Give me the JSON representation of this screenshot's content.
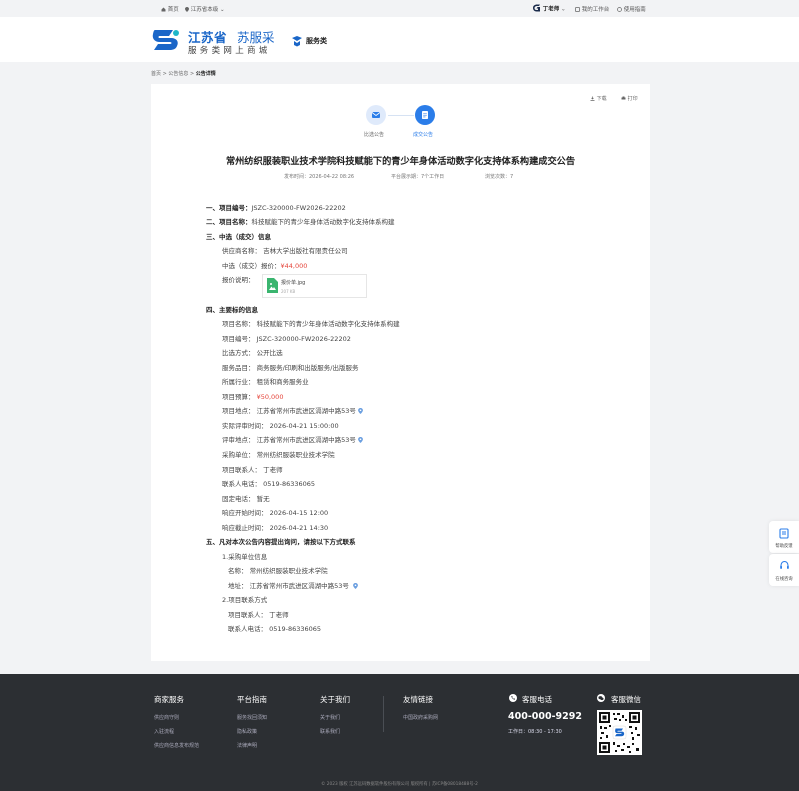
{
  "topbar": {
    "home": "首页",
    "region": "江苏省本级",
    "user": "丁老师",
    "workbench": "我的工作台",
    "guide": "使用指南"
  },
  "header": {
    "brand_cn": "江苏省",
    "brand_name": "苏服采",
    "brand_slogan": "服务类网上商城",
    "service_tag": "服务类"
  },
  "breadcrumb": [
    "首页",
    "公告信息",
    "公告详情"
  ],
  "toolbar": {
    "download": "下载",
    "print": "打印"
  },
  "steps": [
    {
      "label": "比选公告",
      "active": false
    },
    {
      "label": "成交公告",
      "active": true
    }
  ],
  "notice": {
    "title": "常州纺织服装职业技术学院科技赋能下的青少年身体活动数字化支持体系构建成交公告",
    "publish_time": "发布时间：2026-04-22 08:26",
    "display_period": "平台展示期：7个工作日",
    "views": "浏览次数：7"
  },
  "sections": {
    "s1_label": "一、项目编号：",
    "s1_value": "JSZC-320000-FW2026-22202",
    "s2_label": "二、项目名称：",
    "s2_value": "科技赋能下的青少年身体活动数字化支持体系构建",
    "s3_label": "三、中选（成交）信息",
    "supplier": "供应商名称： 吉林大学出版社有限责任公司",
    "price_label": "中选（成交）报价：",
    "price_value": "¥44,000",
    "quote_label": "报价说明：",
    "file_name": "报价单.jpg",
    "file_size": "207 KB",
    "s4_label": "四、主要标的信息",
    "s5_label": "五、凡对本次公告内容提出询问，请按以下方式联系"
  },
  "details": [
    {
      "label": "项目名称：",
      "value": "科技赋能下的青少年身体活动数字化支持体系构建"
    },
    {
      "label": "项目编号：",
      "value": "JSZC-320000-FW2026-22202"
    },
    {
      "label": "比选方式：",
      "value": "公开比选"
    },
    {
      "label": "服务品目：",
      "value": "商务服务/印刷和出版服务/出版服务"
    },
    {
      "label": "所属行业：",
      "value": "租赁和商务服务业"
    },
    {
      "label": "项目预算：",
      "value": "¥50,000"
    },
    {
      "label": "项目地点：",
      "value": "江苏省常州市武进区滆湖中路53号"
    },
    {
      "label": "实际评审时间：",
      "value": "2026-04-21 15:00:00"
    },
    {
      "label": "评审地点：",
      "value": "江苏省常州市武进区滆湖中路53号"
    },
    {
      "label": "采购单位：",
      "value": "常州纺织服装职业技术学院"
    },
    {
      "label": "项目联系人：",
      "value": "丁老师"
    },
    {
      "label": "联系人电话：",
      "value": "0519-86336065"
    },
    {
      "label": "固定电话：",
      "value": "暂无"
    },
    {
      "label": "响应开始时间：",
      "value": "2026-04-15 12:00"
    },
    {
      "label": "响应截止时间：",
      "value": "2026-04-21 14:30"
    }
  ],
  "contact": {
    "unit_heading": "1.采购单位信息",
    "unit_name": "名称： 常州纺织服装职业技术学院",
    "unit_address": "地址： 江苏省常州市武进区滆湖中路53号",
    "project_heading": "2.项目联系方式",
    "project_contact": "项目联系人： 丁老师",
    "project_phone": "联系人电话： 0519-86336065"
  },
  "side_widgets": [
    {
      "label": "帮助反馈"
    },
    {
      "label": "在线咨询"
    }
  ],
  "footer": {
    "col1_title": "商家服务",
    "col1_links": [
      "供应商守则",
      "入驻流程",
      "供应商信息发布规范"
    ],
    "col2_title": "平台指南",
    "col2_links": [
      "服务找回须知",
      "隐私政策",
      "法律声明"
    ],
    "col3_title": "关于我们",
    "col3_links": [
      "关于我们",
      "联系我们"
    ],
    "col4_title": "友情链接",
    "col4_links": [
      "中国政府采购网"
    ],
    "hotline_title": "客服电话",
    "hotline_number": "400-000-9292",
    "hotline_hours": "工作日：08:30 - 17:30",
    "wechat_title": "客服微信",
    "copyright": "© 2023 版权 江苏远码数据软件股份有限公司 版权所有 | 苏ICP备08018488号-2"
  },
  "colors": {
    "brand_blue": "#1a66c8",
    "active_step": "#2b7de9",
    "inactive_step": "#dfeafb",
    "price_red": "#e5443a",
    "footer_bg": "#2c2f33"
  }
}
